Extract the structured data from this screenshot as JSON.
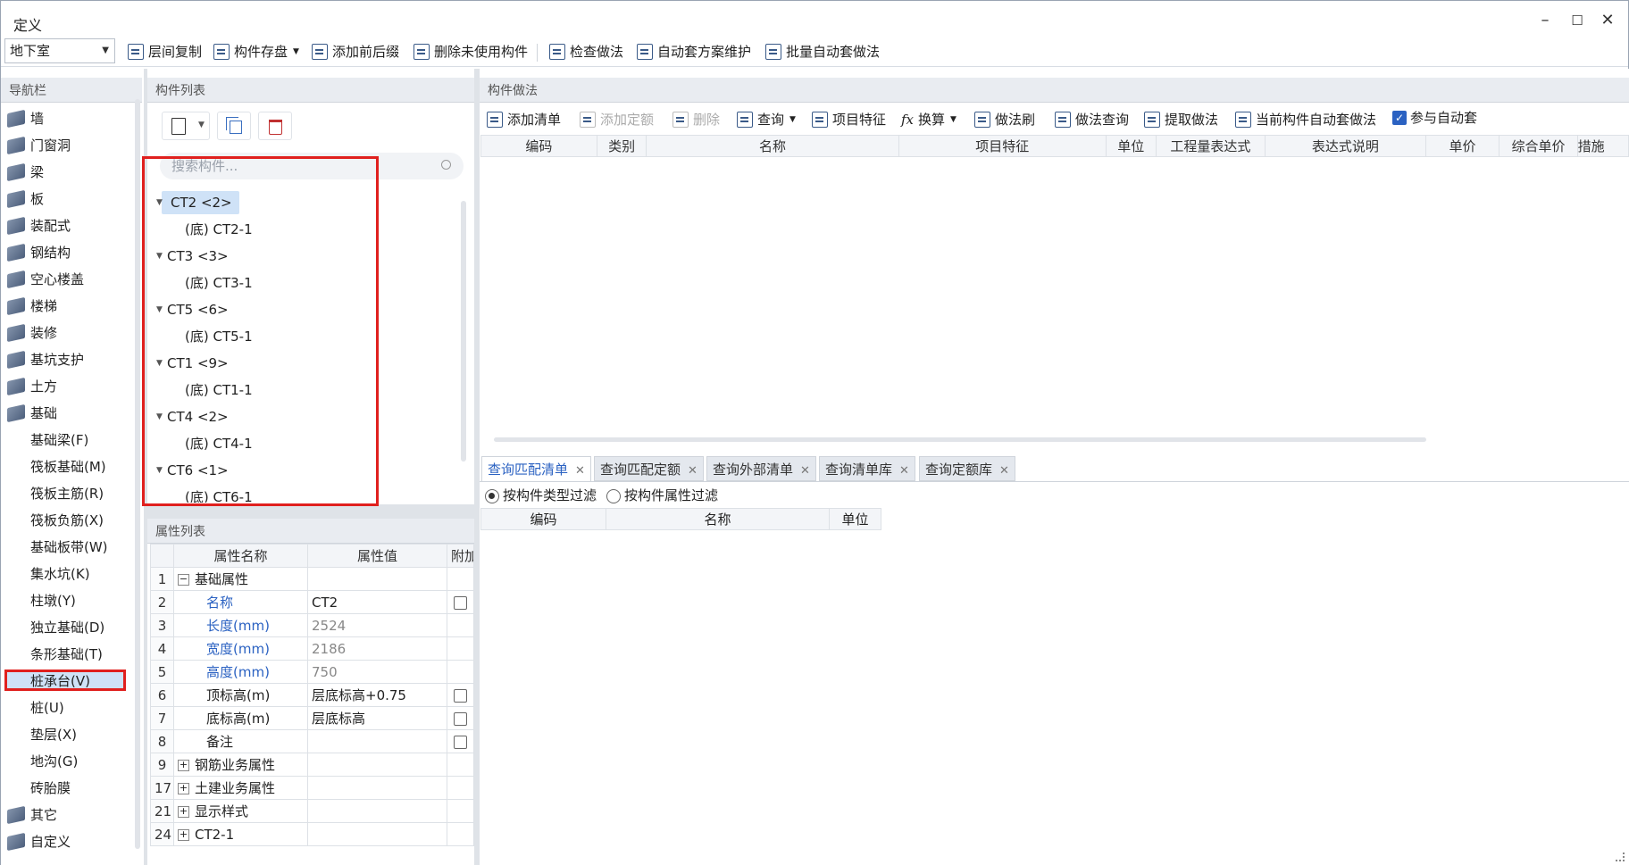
{
  "window": {
    "title": "定义"
  },
  "toolbar": {
    "floor": "地下室",
    "items": [
      "层间复制",
      "构件存盘",
      "添加前后缀",
      "删除未使用构件",
      "检查做法",
      "自动套方案维护",
      "批量自动套做法"
    ]
  },
  "nav": {
    "header": "导航栏",
    "groups": [
      "墙",
      "门窗洞",
      "梁",
      "板",
      "装配式",
      "钢结构",
      "空心楼盖",
      "楼梯",
      "装修",
      "基坑支护",
      "土方",
      "基础"
    ],
    "subitems": [
      "基础梁(F)",
      "筏板基础(M)",
      "筏板主筋(R)",
      "筏板负筋(X)",
      "基础板带(W)",
      "集水坑(K)",
      "柱墩(Y)",
      "独立基础(D)",
      "条形基础(T)",
      "桩承台(V)",
      "桩(U)",
      "垫层(X)",
      "地沟(G)",
      "砖胎膜"
    ],
    "tail": [
      "其它",
      "自定义"
    ]
  },
  "component_list": {
    "header": "构件列表",
    "search_placeholder": "搜索构件...",
    "tree": [
      {
        "name": "CT2 <2>",
        "child": "(底) CT2-1"
      },
      {
        "name": "CT3 <3>",
        "child": "(底) CT3-1"
      },
      {
        "name": "CT5 <6>",
        "child": "(底) CT5-1"
      },
      {
        "name": "CT1 <9>",
        "child": "(底) CT1-1"
      },
      {
        "name": "CT4 <2>",
        "child": "(底) CT4-1"
      },
      {
        "name": "CT6 <1>",
        "child": "(底) CT6-1"
      }
    ]
  },
  "property_list": {
    "header": "属性列表",
    "columns": [
      "属性名称",
      "属性值",
      "附加"
    ],
    "rows": [
      {
        "no": "1",
        "name": "基础属性",
        "value": ""
      },
      {
        "no": "2",
        "name": "名称",
        "value": "CT2"
      },
      {
        "no": "3",
        "name": "长度(mm)",
        "value": "2524"
      },
      {
        "no": "4",
        "name": "宽度(mm)",
        "value": "2186"
      },
      {
        "no": "5",
        "name": "高度(mm)",
        "value": "750"
      },
      {
        "no": "6",
        "name": "顶标高(m)",
        "value": "层底标高+0.75"
      },
      {
        "no": "7",
        "name": "底标高(m)",
        "value": "层底标高"
      },
      {
        "no": "8",
        "name": "备注",
        "value": ""
      },
      {
        "no": "9",
        "name": "钢筋业务属性",
        "value": ""
      },
      {
        "no": "17",
        "name": "土建业务属性",
        "value": ""
      },
      {
        "no": "21",
        "name": "显示样式",
        "value": ""
      },
      {
        "no": "24",
        "name": "CT2-1",
        "value": ""
      }
    ]
  },
  "method_panel": {
    "header": "构件做法",
    "toolbar": [
      "添加清单",
      "添加定额",
      "删除",
      "查询",
      "项目特征",
      "换算",
      "做法刷",
      "做法查询",
      "提取做法",
      "当前构件自动套做法",
      "参与自动套"
    ],
    "columns": [
      "编码",
      "类别",
      "名称",
      "项目特征",
      "单位",
      "工程量表达式",
      "表达式说明",
      "单价",
      "综合单价",
      "措施"
    ],
    "tabs": [
      "查询匹配清单",
      "查询匹配定额",
      "查询外部清单",
      "查询清单库",
      "查询定额库"
    ],
    "filters": [
      "按构件类型过滤",
      "按构件属性过滤"
    ],
    "query_columns": [
      "编码",
      "名称",
      "单位"
    ]
  }
}
